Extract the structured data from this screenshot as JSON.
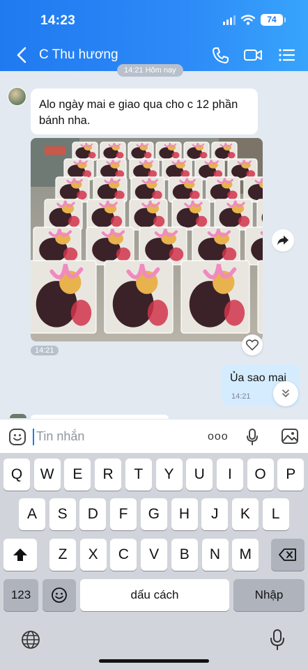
{
  "status": {
    "time": "14:23",
    "battery": "74"
  },
  "header": {
    "title": "C Thu hương"
  },
  "chat": {
    "day_chip": "14:21 Hôm nay",
    "incoming_text": "Alo ngày mai e giao qua cho c 12 phần bánh nha.",
    "photo_time": "14:21",
    "outgoing_text": "Ủa sao mai",
    "outgoing_time": "14:21"
  },
  "input": {
    "placeholder": "Tin nhắn",
    "more": "ooo"
  },
  "keyboard": {
    "row1": [
      "Q",
      "W",
      "E",
      "R",
      "T",
      "Y",
      "U",
      "I",
      "O",
      "P"
    ],
    "row2": [
      "A",
      "S",
      "D",
      "F",
      "G",
      "H",
      "J",
      "K",
      "L"
    ],
    "row3": [
      "Z",
      "X",
      "C",
      "V",
      "B",
      "N",
      "M"
    ],
    "numbers": "123",
    "space": "dấu cách",
    "return": "Nhập"
  },
  "icons": [
    "back-icon",
    "phone-icon",
    "video-call-icon",
    "menu-icon",
    "share-icon",
    "heart-icon",
    "scroll-down-icon",
    "sticker-icon",
    "mic-icon",
    "image-icon",
    "shift-icon",
    "backspace-icon",
    "emoji-icon",
    "globe-icon",
    "dictation-icon"
  ],
  "colors": {
    "header": "#2d8af7",
    "outgoing_bubble": "#d5ecff",
    "chat_bg": "#e2e9f1"
  }
}
